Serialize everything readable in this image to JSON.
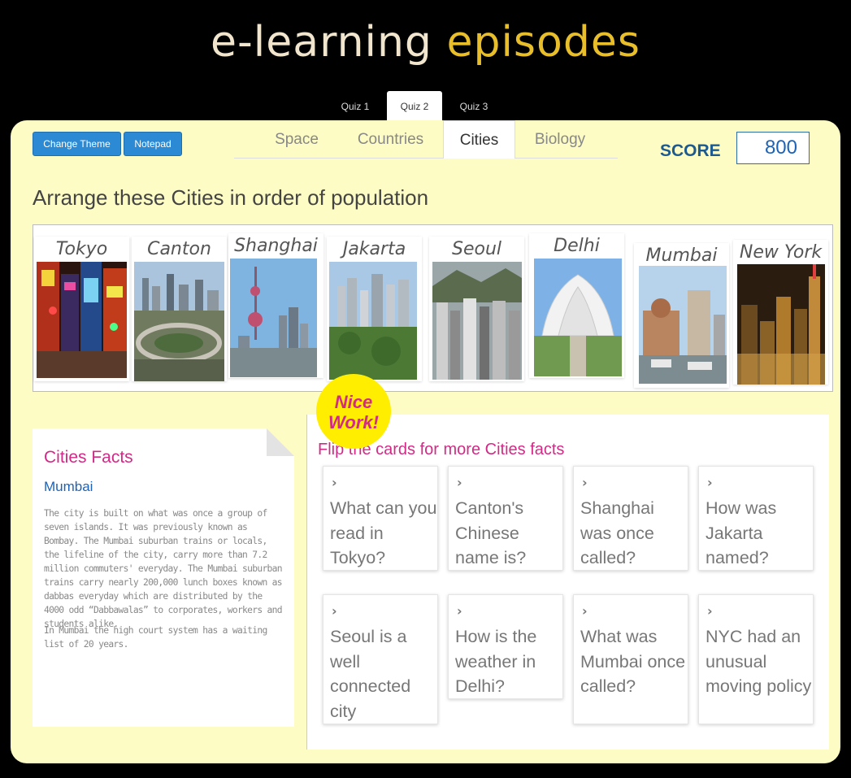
{
  "logo": {
    "part1": "e-learning",
    "part2": "episodes"
  },
  "quiz_tabs": [
    {
      "label": "Quiz 1",
      "active": false
    },
    {
      "label": "Quiz 2",
      "active": true
    },
    {
      "label": "Quiz 3",
      "active": false
    }
  ],
  "buttons": {
    "change_theme": "Change Theme",
    "notepad": "Notepad"
  },
  "category_tabs": [
    {
      "label": "Space",
      "active": false
    },
    {
      "label": "Countries",
      "active": false
    },
    {
      "label": "Cities",
      "active": true
    },
    {
      "label": "Biology",
      "active": false
    }
  ],
  "score": {
    "label": "SCORE",
    "value": "800"
  },
  "instruction": "Arrange these Cities in order of population",
  "cities": [
    "Tokyo",
    "Canton",
    "Shanghai",
    "Jakarta",
    "Seoul",
    "Delhi",
    "Mumbai",
    "New York"
  ],
  "badge": {
    "line1": "Nice",
    "line2": "Work!"
  },
  "facts": {
    "title": "Cities Facts",
    "city": "Mumbai",
    "p1": "The city is built on what was once a group of seven islands. It was previously known as Bombay. The Mumbai suburban trains or locals, the lifeline of the city, carry more than 7.2 million commuters' everyday. The Mumbai suburban trains carry nearly 200,000 lunch boxes known as dabbas everyday which are distributed by the 4000 odd “Dabbawalas” to corporates, workers and students alike.",
    "p2": "In Mumbai the high court system has a waiting list of 20 years."
  },
  "flip": {
    "title": "Flip the cards for more Cities facts",
    "cards": [
      "What can you read in Tokyo?",
      "Canton's Chinese name is?",
      "Shanghai was once called?",
      "How was Jakarta named?",
      "Seoul is a well connected city",
      "How is the weather in Delhi?",
      "What was Mumbai once called?",
      "NYC had an unusual moving policy"
    ]
  },
  "colors": {
    "accent_pink": "#d22a86",
    "accent_blue": "#1d63b8",
    "panel_bg": "#fdfcc4",
    "button_blue": "#2b8ad3"
  }
}
